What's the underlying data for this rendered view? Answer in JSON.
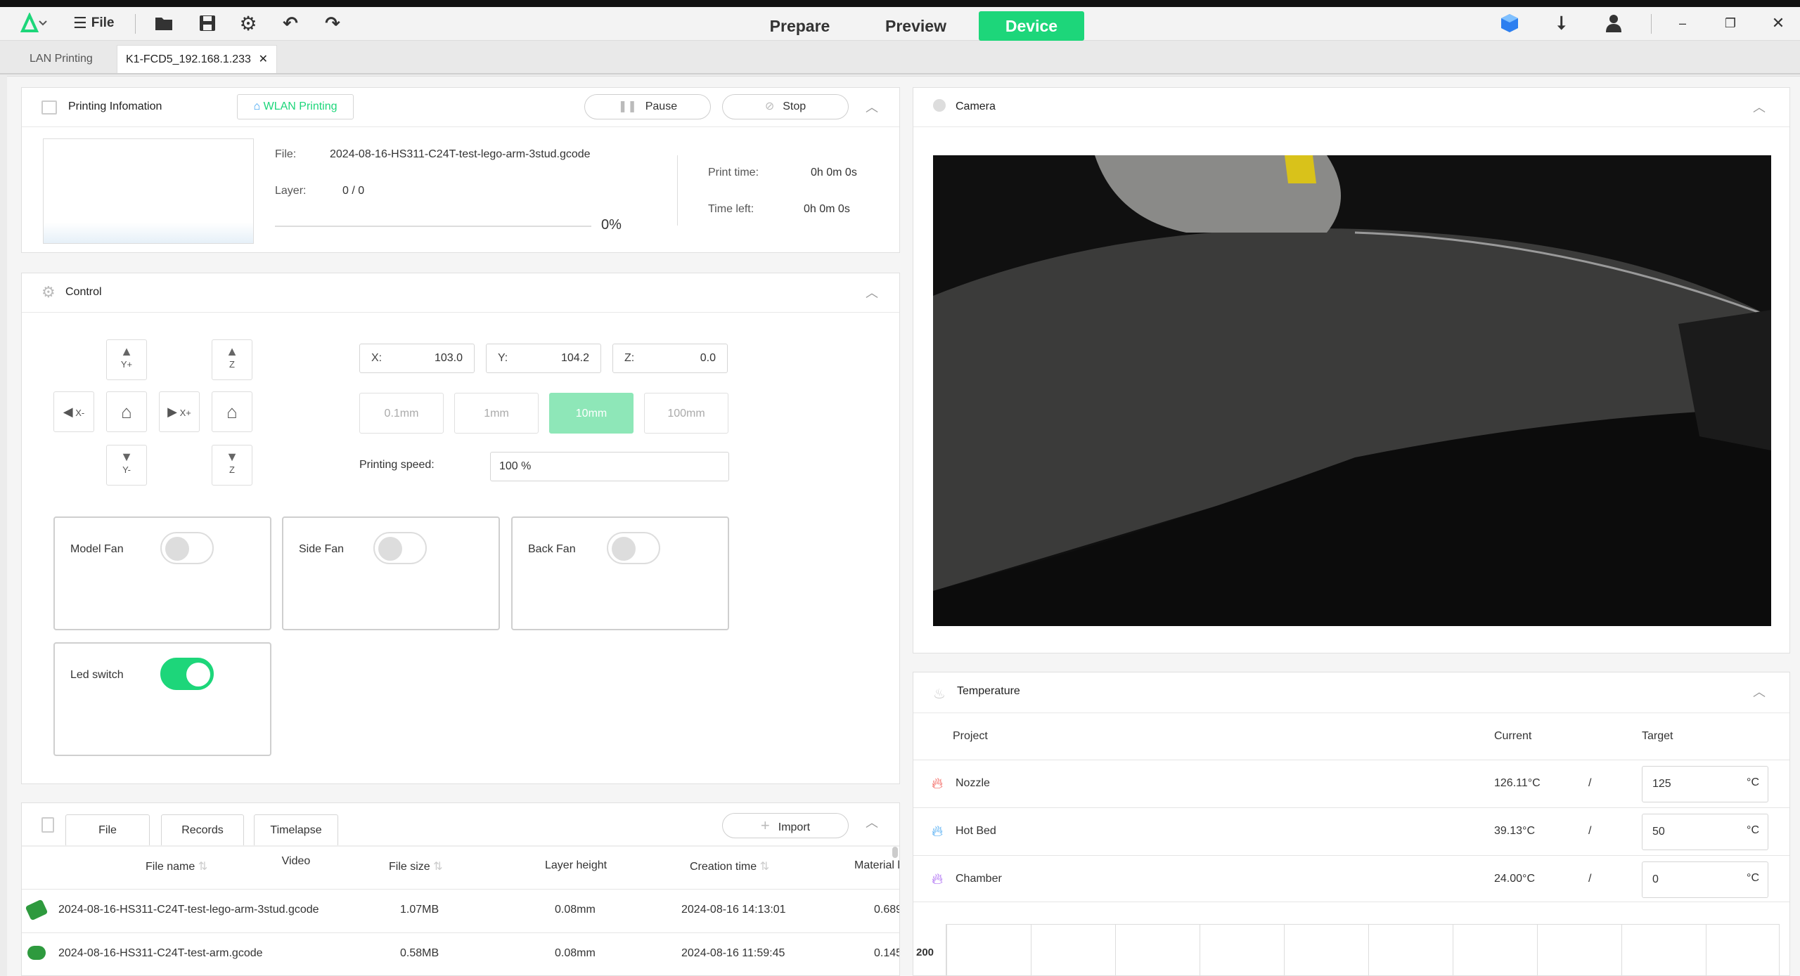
{
  "topbar": {
    "file_label": "File",
    "nav": {
      "prepare": "Prepare",
      "preview": "Preview",
      "device": "Device"
    },
    "colors": {
      "accent": "#1dd67a"
    }
  },
  "tabs": [
    {
      "label": "LAN Printing"
    },
    {
      "label": "K1-FCD5_192.168.1.233",
      "close": "✕"
    }
  ],
  "printing": {
    "title": "Printing Infomation",
    "wlan_label": "WLAN Printing",
    "pause_label": "Pause",
    "stop_label": "Stop",
    "file_label": "File:",
    "file_value": "2024-08-16-HS311-C24T-test-lego-arm-3stud.gcode",
    "layer_label": "Layer:",
    "layer_value": "0 / 0",
    "progress_value": "0%",
    "progress": 0,
    "print_time_label": "Print time:",
    "print_time_value": "0h 0m 0s",
    "time_left_label": "Time left:",
    "time_left_value": "0h 0m 0s"
  },
  "control": {
    "title": "Control",
    "jog": {
      "y_plus": "Y+",
      "y_minus": "Y-",
      "x_minus": "X-",
      "x_plus": "X+",
      "z_up": "Z",
      "z_down": "Z"
    },
    "coords": [
      {
        "label": "X:",
        "value": "103.0"
      },
      {
        "label": "Y:",
        "value": "104.2"
      },
      {
        "label": "Z:",
        "value": "0.0"
      }
    ],
    "steps": [
      "0.1mm",
      "1mm",
      "10mm",
      "100mm"
    ],
    "active_step": "10mm",
    "speed_label": "Printing speed:",
    "speed_value": "100 %",
    "fans": [
      {
        "label": "Model Fan",
        "on": false
      },
      {
        "label": "Side Fan",
        "on": false
      },
      {
        "label": "Back Fan",
        "on": false
      }
    ],
    "led": {
      "label": "Led switch",
      "on": true
    }
  },
  "files": {
    "buttons": {
      "file": "File",
      "records": "Records",
      "timelapse": "Timelapse Video",
      "import": "Import"
    },
    "headers": [
      "File name",
      "File size",
      "Layer height",
      "Creation time",
      "Material l"
    ],
    "rows": [
      {
        "name": "2024-08-16-HS311-C24T-test-lego-arm-3stud.gcode",
        "size": "1.07MB",
        "layer": "0.08mm",
        "created": "2024-08-16 14:13:01",
        "material": "0.689"
      },
      {
        "name": "2024-08-16-HS311-C24T-test-arm.gcode",
        "size": "0.58MB",
        "layer": "0.08mm",
        "created": "2024-08-16 11:59:45",
        "material": "0.145"
      }
    ]
  },
  "camera": {
    "title": "Camera"
  },
  "temperature": {
    "title": "Temperature",
    "headers": {
      "project": "Project",
      "current": "Current",
      "target": "Target"
    },
    "rows": [
      {
        "name": "Nozzle",
        "current": "126.11°C",
        "sep": "/",
        "target": "125",
        "unit": "°C",
        "color": "#f0413a"
      },
      {
        "name": "Hot Bed",
        "current": "39.13°C",
        "sep": "/",
        "target": "50",
        "unit": "°C",
        "color": "#2d9bf0"
      },
      {
        "name": "Chamber",
        "current": "24.00°C",
        "sep": "/",
        "target": "0",
        "unit": "°C",
        "color": "#9b4df0"
      }
    ],
    "chart_ymax_label": "200"
  }
}
